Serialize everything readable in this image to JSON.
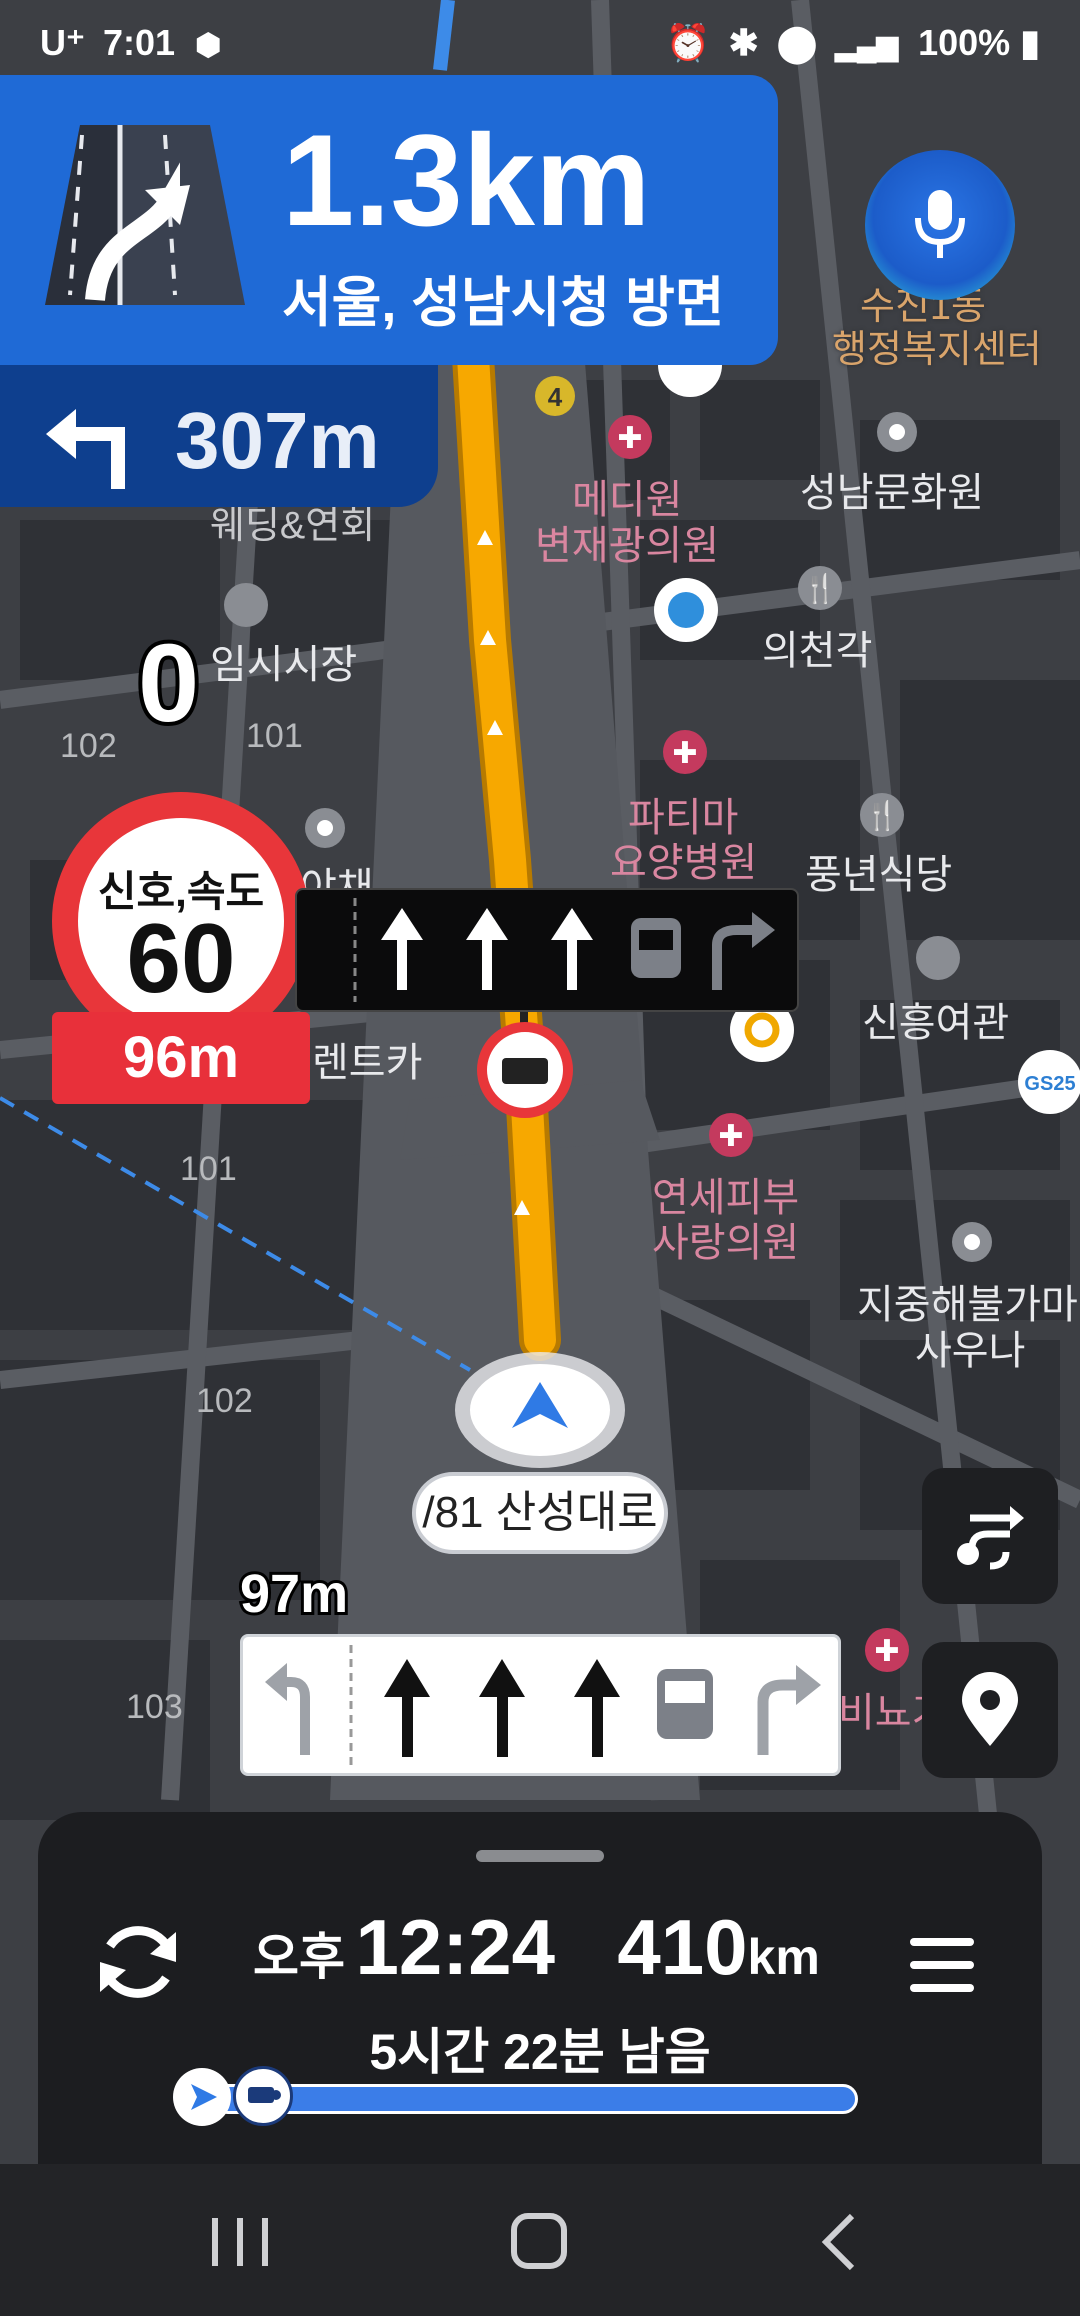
{
  "status_bar": {
    "carrier": "U⁺",
    "time": "7:01",
    "battery": "100%"
  },
  "guidance": {
    "distance": "1.3km",
    "direction": "서울, 성남시청 방면",
    "next_turn_distance": "307m"
  },
  "speed_current": "0",
  "speed_limit": {
    "label": "신호,속도",
    "value": "60",
    "distance": "96m"
  },
  "lane_guide_distance": "97m",
  "road_name": "/81 산성대로",
  "map_labels": {
    "center1": "수진1동",
    "center2": "행정복지센터",
    "medi1": "메디원",
    "medi2": "변재광의원",
    "culture": "성남문화원",
    "uicheon": "의천각",
    "market": "임시시장",
    "partima1": "파티마",
    "partima2": "요양병원",
    "pungnyeon": "풍년식당",
    "hotel": "신흥여관",
    "yonsei1": "연세피부",
    "yonsei2": "사랑의원",
    "sauna1": "지중해불가마",
    "sauna2": "사우나",
    "rentcar": "렌트카",
    "veg": "야채",
    "wedding": "웨딩&연회",
    "clinic_right": "비뇨기",
    "gs25": "GS25",
    "route_badge": "4",
    "n102a": "102",
    "n101a": "101",
    "n101b": "101",
    "n102b": "102",
    "n103": "103"
  },
  "bottom_panel": {
    "eta_ampm": "오후",
    "eta_time": "12:24",
    "distance_value": "410",
    "distance_unit": "km",
    "remaining": "5시간 22분 남음"
  },
  "colors": {
    "guide_blue": "#1f6ad6",
    "guide_dark_blue": "#0e3f8e",
    "route_orange": "#f7a500",
    "limit_red": "#e8303a"
  }
}
